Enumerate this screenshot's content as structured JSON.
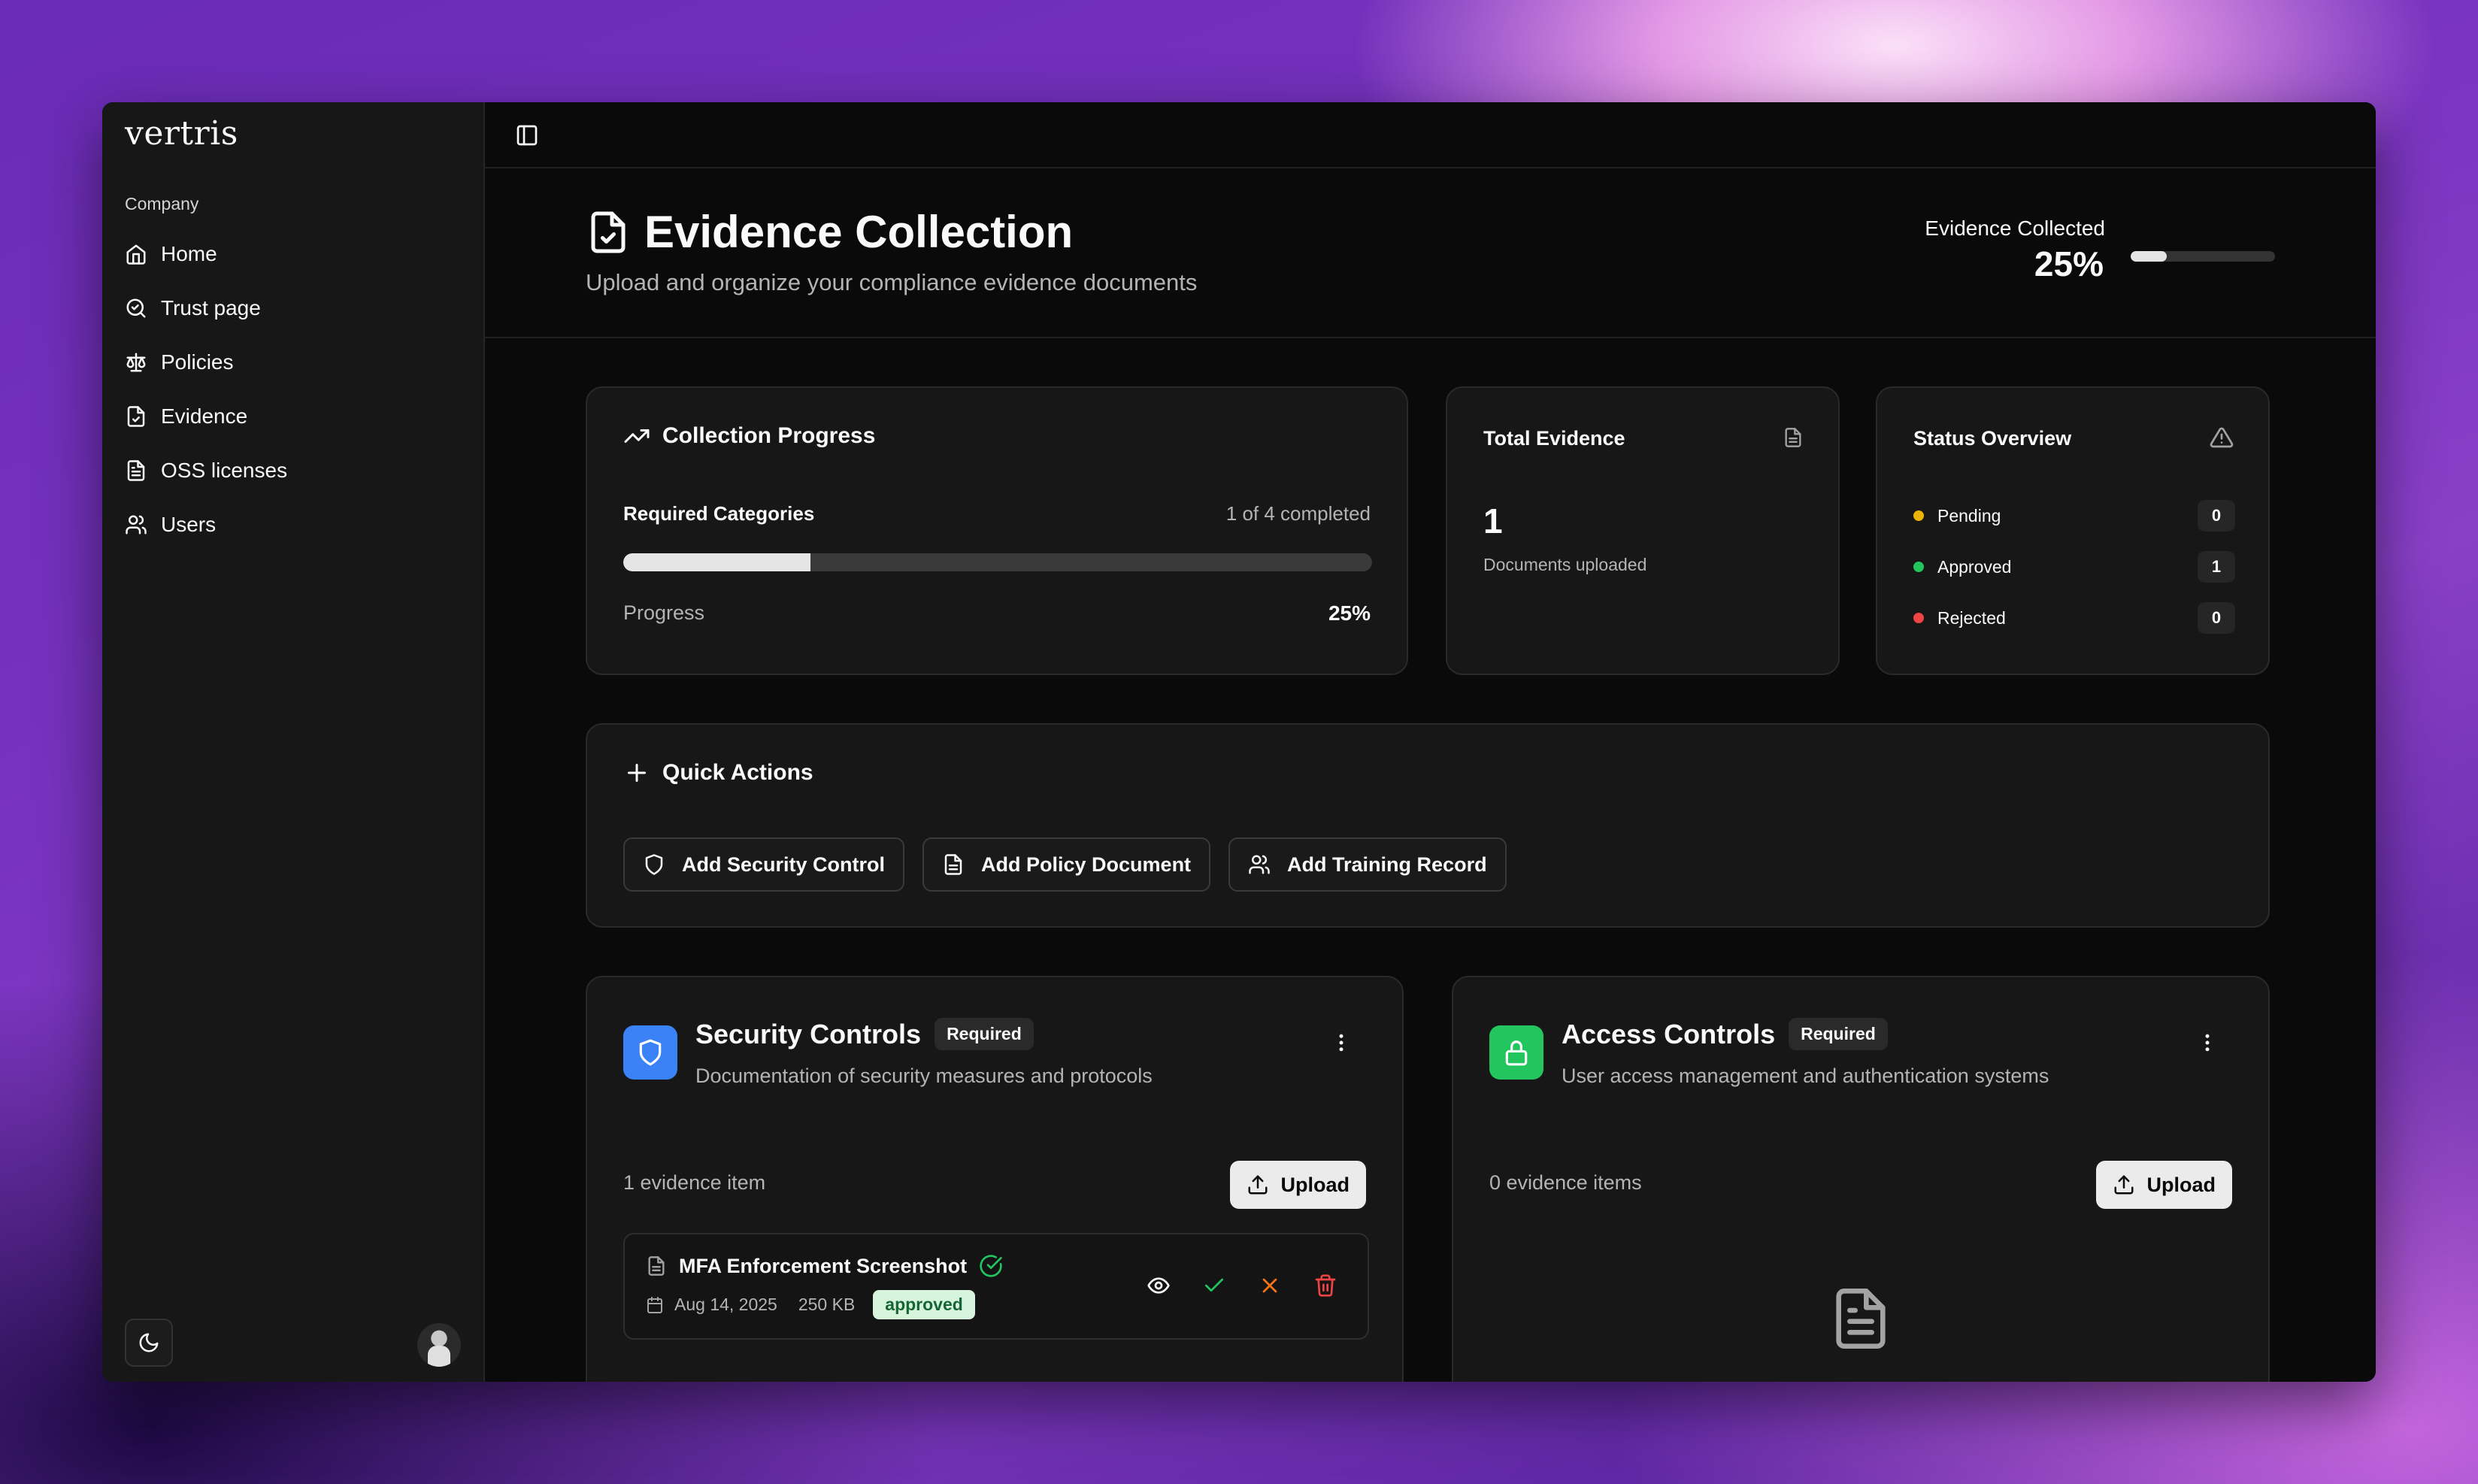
{
  "sidebar": {
    "logo": "vertris",
    "group_label": "Company",
    "items": [
      {
        "label": "Home",
        "icon": "home-icon"
      },
      {
        "label": "Trust page",
        "icon": "trust-icon"
      },
      {
        "label": "Policies",
        "icon": "scale-icon"
      },
      {
        "label": "Evidence",
        "icon": "file-check-icon"
      },
      {
        "label": "OSS licenses",
        "icon": "file-text-icon"
      },
      {
        "label": "Users",
        "icon": "users-icon"
      }
    ]
  },
  "header": {
    "title": "Evidence Collection",
    "subtitle": "Upload and organize your compliance evidence documents",
    "evidence_collected_label": "Evidence Collected",
    "evidence_collected_value": "25%",
    "evidence_collected_fraction": 0.25
  },
  "collection_progress": {
    "title": "Collection Progress",
    "required_label": "Required Categories",
    "required_count": "1 of 4 completed",
    "progress_label": "Progress",
    "progress_value": "25%",
    "progress_fraction": 0.25
  },
  "total_evidence": {
    "title": "Total Evidence",
    "count": "1",
    "label": "Documents uploaded"
  },
  "status_overview": {
    "title": "Status Overview",
    "rows": [
      {
        "label": "Pending",
        "count": "0",
        "color": "#eab308"
      },
      {
        "label": "Approved",
        "count": "1",
        "color": "#22c55e"
      },
      {
        "label": "Rejected",
        "count": "0",
        "color": "#ef4444"
      }
    ]
  },
  "quick_actions": {
    "title": "Quick Actions",
    "buttons": [
      {
        "label": "Add Security Control",
        "icon": "shield-icon"
      },
      {
        "label": "Add Policy Document",
        "icon": "file-text-icon"
      },
      {
        "label": "Add Training Record",
        "icon": "users-icon"
      }
    ]
  },
  "categories": [
    {
      "title": "Security Controls",
      "badge": "Required",
      "description": "Documentation of security measures and protocols",
      "count_label": "1 evidence item",
      "upload_label": "Upload",
      "icon_color": "#3b82f6",
      "items": [
        {
          "name": "MFA Enforcement Screenshot",
          "date": "Aug 14, 2025",
          "size": "250 KB",
          "status": "approved"
        }
      ]
    },
    {
      "title": "Access Controls",
      "badge": "Required",
      "description": "User access management and authentication systems",
      "count_label": "0 evidence items",
      "upload_label": "Upload",
      "icon_color": "#22c55e",
      "items": []
    }
  ]
}
